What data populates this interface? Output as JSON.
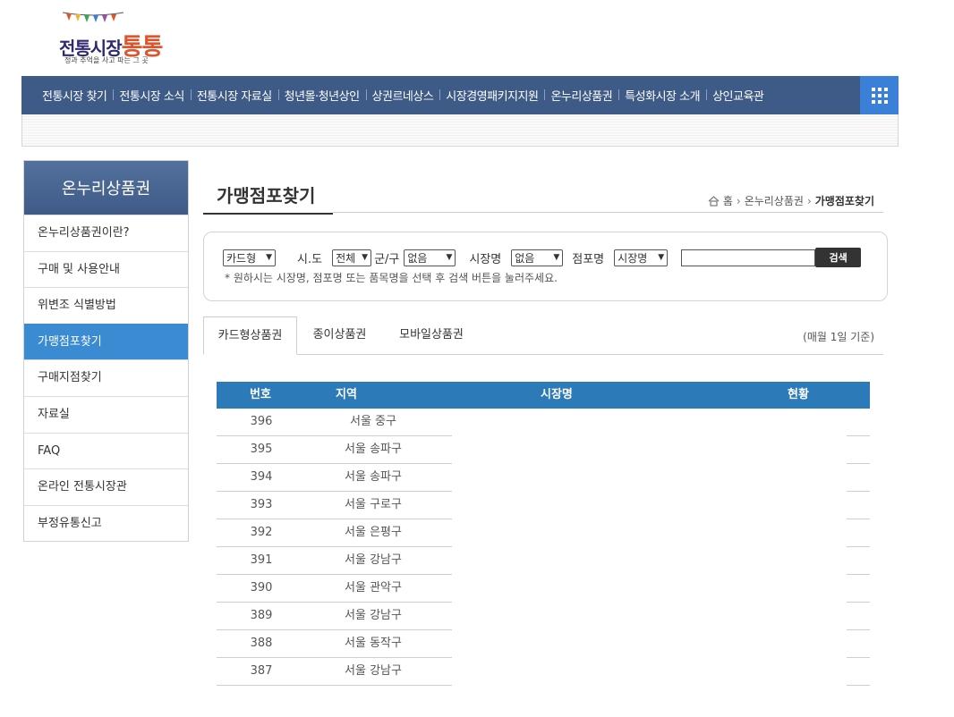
{
  "logo": {
    "title_part1": "전통시장",
    "title_part2": "통통",
    "tagline": "정과 추억을 사고 파는 그 곳"
  },
  "topnav": {
    "items": [
      "전통시장 찾기",
      "전통시장 소식",
      "전통시장 자료실",
      "청년몰·청년상인",
      "상권르네상스",
      "시장경영패키지지원",
      "온누리상품권",
      "특성화시장 소개",
      "상인교육관"
    ]
  },
  "sidebar": {
    "title": "온누리상품권",
    "items": [
      "온누리상품권이란?",
      "구매 및 사용안내",
      "위변조 식별방법",
      "가맹점포찾기",
      "구매지점찾기",
      "자료실",
      "FAQ",
      "온라인 전통시장관",
      "부정유통신고"
    ],
    "active_index": 3
  },
  "page": {
    "title": "가맹점포찾기",
    "breadcrumb": [
      "홈",
      "온누리상품권",
      "가맹점포찾기"
    ]
  },
  "search": {
    "type_value": "카드형",
    "sido_label": "시.도",
    "sido_value": "전체",
    "gungu_label": "군/구",
    "gungu_value": "없음",
    "market_label": "시장명",
    "market_value": "없음",
    "store_label": "점포명",
    "store_value": "시장명",
    "keyword_value": "",
    "button": "검색",
    "hint": "* 원하시는 시장명, 점포명 또는 품목명을 선택 후 검색 버튼을 눌러주세요."
  },
  "tabs": {
    "items": [
      "카드형상품권",
      "종이상품권",
      "모바일상품권"
    ],
    "active_index": 0,
    "basis": "(매월 1일 기준)"
  },
  "table": {
    "headers": [
      "번호",
      "지역",
      "시장명",
      "현황"
    ],
    "rows": [
      {
        "num": "396",
        "region": "서울 중구"
      },
      {
        "num": "395",
        "region": "서울 송파구"
      },
      {
        "num": "394",
        "region": "서울 송파구"
      },
      {
        "num": "393",
        "region": "서울 구로구"
      },
      {
        "num": "392",
        "region": "서울 은평구"
      },
      {
        "num": "391",
        "region": "서울 강남구"
      },
      {
        "num": "390",
        "region": "서울 관악구"
      },
      {
        "num": "389",
        "region": "서울 강남구"
      },
      {
        "num": "388",
        "region": "서울 동작구"
      },
      {
        "num": "387",
        "region": "서울 강남구"
      }
    ]
  },
  "colors": {
    "nav_bg": "#3e5a86",
    "grid_button": "#3a7fd8",
    "sidebar_active": "#3a8bd1",
    "table_header": "#2d7ab8",
    "logo_accent": "#e1532a"
  }
}
